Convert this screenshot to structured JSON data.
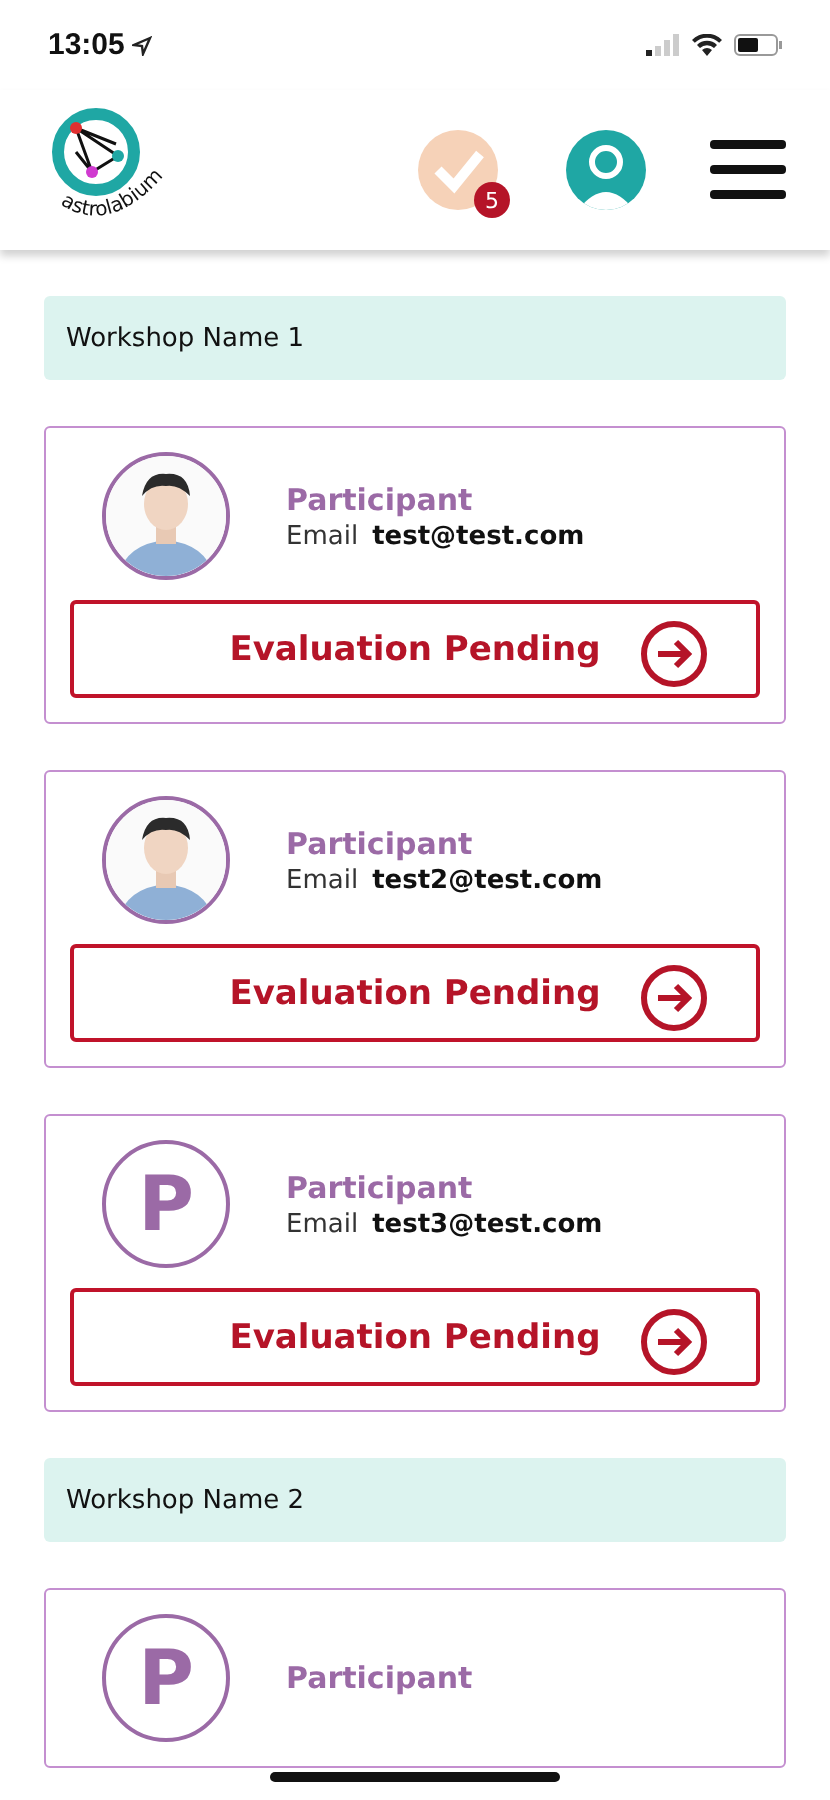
{
  "status_bar": {
    "time": "13:05"
  },
  "header": {
    "logo_text": "astrolabium",
    "badge_count": "5"
  },
  "workshops": [
    {
      "name": "Workshop Name 1",
      "participants": [
        {
          "role": "Participant",
          "email_label": "Email",
          "email": "test@test.com",
          "action": "Evaluation Pending"
        },
        {
          "role": "Participant",
          "email_label": "Email",
          "email": "test2@test.com",
          "action": "Evaluation Pending"
        },
        {
          "avatar": {
            "kind": "letter",
            "letter": "P"
          },
          "role": "Participant",
          "email_label": "Email",
          "email": "test3@test.com",
          "action": "Evaluation Pending"
        }
      ]
    },
    {
      "name": "Workshop Name 2",
      "participants": [
        {
          "avatar": {
            "kind": "letter",
            "letter": "P"
          },
          "role": "Participant"
        }
      ]
    }
  ]
}
